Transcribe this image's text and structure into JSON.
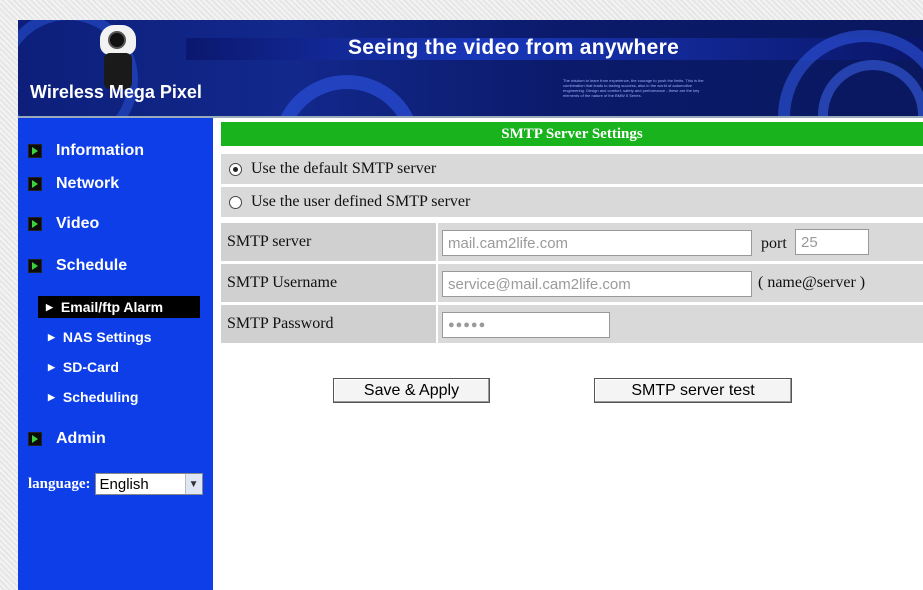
{
  "banner": {
    "headline": "Seeing the video from anywhere",
    "brand": "Wireless Mega Pixel",
    "fine_print": "The wisdom to learn from experience, the courage to push the limits. This is the combination that leads to lasting success, also in the world of automotive engineering. Design and comfort, safety and performance - these are the key elements of the nature of the BMW 5 Series."
  },
  "sidebar": {
    "items": [
      {
        "label": "Information"
      },
      {
        "label": "Network"
      },
      {
        "label": "Video"
      },
      {
        "label": "Schedule"
      },
      {
        "label": "Admin"
      }
    ],
    "sub_items": [
      {
        "label": "Email/ftp Alarm",
        "active": true
      },
      {
        "label": "NAS Settings"
      },
      {
        "label": "SD-Card"
      },
      {
        "label": "Scheduling"
      }
    ],
    "language_label": "language:",
    "language_value": "English"
  },
  "main": {
    "section_title": "SMTP Server Settings",
    "radio_default": "Use the default SMTP server",
    "radio_user": "Use the user defined SMTP server",
    "selected_radio": "default",
    "server_label": "SMTP server",
    "server_value": "mail.cam2life.com",
    "port_label": "port",
    "port_value": "25",
    "username_label": "SMTP Username",
    "username_value": "service@mail.cam2life.com",
    "username_hint": "( name@server )",
    "password_label": "SMTP Password",
    "password_value": "●●●●●",
    "save_button": "Save & Apply",
    "test_button": "SMTP server test"
  },
  "colors": {
    "sidebar_bg": "#0d3ee8",
    "section_bar": "#19b31d",
    "banner_bg": "#0d1f7a"
  }
}
